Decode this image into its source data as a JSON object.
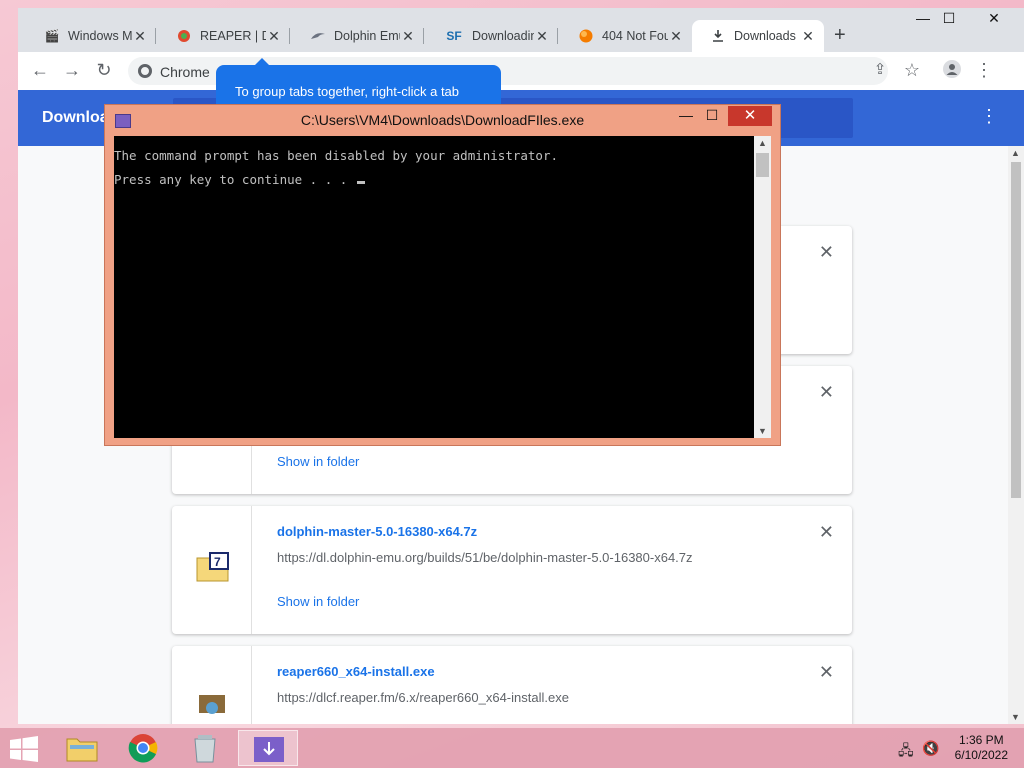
{
  "browser": {
    "tabs": [
      {
        "title": "Windows Mo",
        "icon": "clapper-icon",
        "active": false
      },
      {
        "title": "REAPER | Do",
        "icon": "reaper-icon",
        "active": false
      },
      {
        "title": "Dolphin Emu",
        "icon": "dolphin-icon",
        "active": false
      },
      {
        "title": "Downloading",
        "icon": "sf-icon",
        "active": false
      },
      {
        "title": "404 Not Fou",
        "icon": "orange-circle-icon",
        "active": false
      },
      {
        "title": "Downloads",
        "icon": "download-icon",
        "active": true
      }
    ],
    "new_tab_symbol": "+",
    "window_controls": {
      "minimize": "—",
      "maximize": "☐",
      "close": "✕"
    },
    "omnibox_site": "Chrome",
    "tooltip": "To group tabs together, right-click a tab"
  },
  "downloads_page": {
    "header_title": "Downloads",
    "menu_symbol": "⋮",
    "items": [
      {
        "filename": "",
        "url": "",
        "show_in_folder": ""
      },
      {
        "filename": "",
        "url": "",
        "show_in_folder": "Show in folder"
      },
      {
        "filename": "dolphin-master-5.0-16380-x64.7z",
        "url": "https://dl.dolphin-emu.org/builds/51/be/dolphin-master-5.0-16380-x64.7z",
        "show_in_folder": "Show in folder"
      },
      {
        "filename": "reaper660_x64-install.exe",
        "url": "https://dlcf.reaper.fm/6.x/reaper660_x64-install.exe",
        "show_in_folder": ""
      }
    ]
  },
  "console": {
    "title": "C:\\Users\\VM4\\Downloads\\DownloadFIles.exe",
    "lines": [
      "The command prompt has been disabled by your administrator.",
      "Press any key to continue . . . "
    ]
  },
  "taskbar": {
    "time": "1:36 PM",
    "date": "6/10/2022"
  },
  "colors": {
    "chrome_header_blue": "#3367d6",
    "tooltip_blue": "#1a73e8",
    "console_frame": "#f0a185",
    "console_close": "#c8372c",
    "taskbar": "#e2a0b0"
  }
}
